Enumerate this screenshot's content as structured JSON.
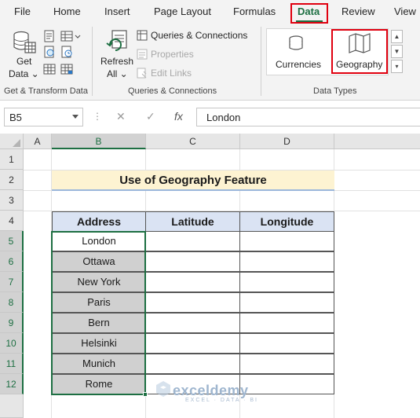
{
  "tabs": [
    {
      "label": "File",
      "active": false
    },
    {
      "label": "Home",
      "active": false
    },
    {
      "label": "Insert",
      "active": false
    },
    {
      "label": "Page Layout",
      "active": false
    },
    {
      "label": "Formulas",
      "active": false
    },
    {
      "label": "Data",
      "active": true
    },
    {
      "label": "Review",
      "active": false
    },
    {
      "label": "View",
      "active": false
    }
  ],
  "ribbon": {
    "get_data": {
      "line1": "Get",
      "line2": "Data ⌄"
    },
    "refresh": {
      "line1": "Refresh",
      "line2": "All ⌄"
    },
    "queries_connections": "Queries & Connections",
    "properties": "Properties",
    "edit_links": "Edit Links",
    "currencies": "Currencies",
    "geography": "Geography",
    "groups": {
      "get_transform": "Get & Transform Data",
      "queries": "Queries & Connections",
      "data_types": "Data Types"
    }
  },
  "formula_bar": {
    "name_box": "B5",
    "cancel_symbol": "✕",
    "enter_symbol": "✓",
    "fx_symbol": "fx",
    "value": "London"
  },
  "columns": [
    "A",
    "B",
    "C",
    "D"
  ],
  "rows": [
    "1",
    "2",
    "3",
    "4",
    "5",
    "6",
    "7",
    "8",
    "9",
    "10",
    "11",
    "12"
  ],
  "sheet": {
    "title": "Use of Geography Feature",
    "headers": [
      "Address",
      "Latitude",
      "Longitude"
    ],
    "addresses": [
      "London",
      "Ottawa",
      "New York",
      "Paris",
      "Bern",
      "Helsinki",
      "Munich",
      "Rome"
    ],
    "latitudes": [
      "",
      "",
      "",
      "",
      "",
      "",
      "",
      ""
    ],
    "longitudes": [
      "",
      "",
      "",
      "",
      "",
      "",
      "",
      ""
    ]
  },
  "watermark": {
    "name": "exceldemy",
    "tagline": "EXCEL · DATA · BI"
  },
  "colors": {
    "accent": "#1d6f42",
    "highlight": "#e0000f",
    "header_fill": "#dae3f3",
    "title_fill": "#fdf3d2",
    "selected_fill": "#d0d0d0"
  }
}
